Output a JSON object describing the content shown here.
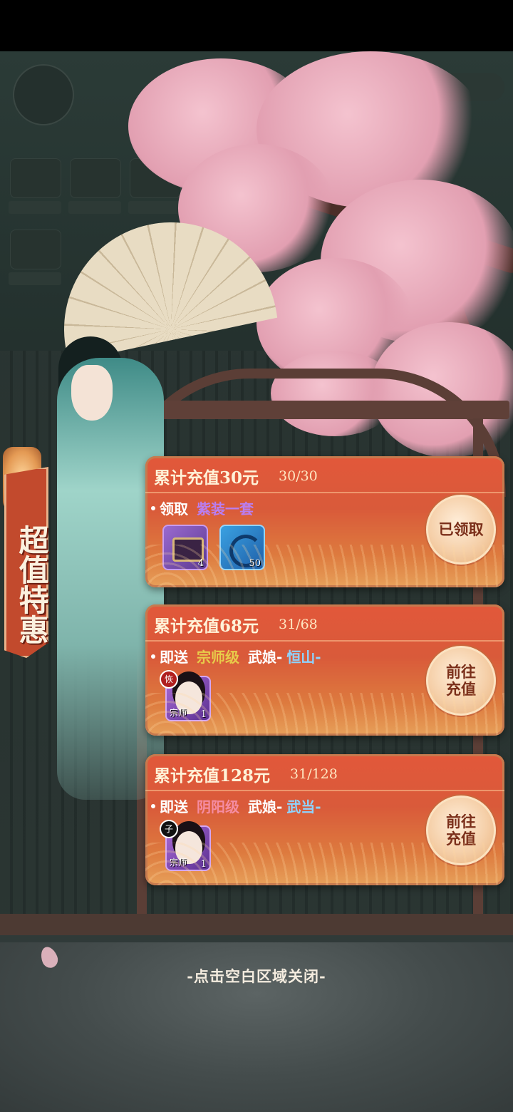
{
  "banner": {
    "title": "超值特惠"
  },
  "rewards": [
    {
      "title": "累计充值30元",
      "progress": "30/30",
      "prefix": "领取",
      "reward_name": "紫装一套",
      "items": [
        {
          "icon": "chest-icon",
          "count": "4"
        },
        {
          "icon": "orb-icon",
          "count": "50"
        }
      ],
      "button": "已领取"
    },
    {
      "title": "累计充值68元",
      "progress": "31/68",
      "prefix": "即送",
      "grade": "宗师级",
      "mid": "武娘-",
      "hero_name": "恒山-",
      "items": [
        {
          "icon": "hero-portrait-icon",
          "count": "1",
          "tag": "宗师",
          "badge": "恢"
        }
      ],
      "button_line1": "前往",
      "button_line2": "充值"
    },
    {
      "title": "累计充值128元",
      "progress": "31/128",
      "prefix": "即送",
      "grade": "阴阳级",
      "mid": "武娘-",
      "hero_name": "武当-",
      "items": [
        {
          "icon": "hero-portrait-icon",
          "count": "1",
          "tag": "宗师",
          "badge": "子"
        }
      ],
      "button_line1": "前往",
      "button_line2": "充值"
    }
  ],
  "close_hint": "-点击空白区域关闭-",
  "colors": {
    "card_red": "#e2583a",
    "grade_purple": "#b97ef0",
    "grade_gold": "#e8cc4a",
    "grade_pink": "#f58ca2",
    "hero_blue": "#8ed4ff"
  }
}
